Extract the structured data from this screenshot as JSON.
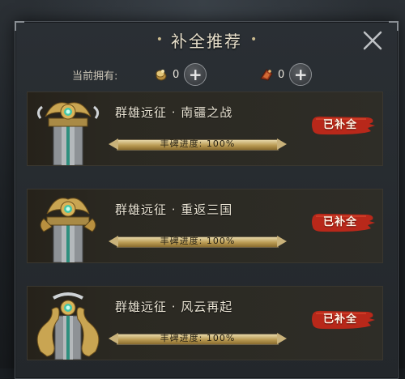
{
  "dialog": {
    "title": "补全推荐",
    "title_dot": "•"
  },
  "owned": {
    "label": "当前拥有:",
    "resources": [
      {
        "icon": "gold-token-icon",
        "count": "0"
      },
      {
        "icon": "red-token-icon",
        "count": "0"
      }
    ],
    "plus_label": "+"
  },
  "items": [
    {
      "name": "群雄远征 · 南疆之战",
      "progress_label": "丰碑进度: 100%",
      "progress": 1.0,
      "status": "已补全",
      "image": "monument-dragon-gold"
    },
    {
      "name": "群雄远征 · 重返三国",
      "progress_label": "丰碑进度: 100%",
      "progress": 1.0,
      "status": "已补全",
      "image": "monument-dragon-gold"
    },
    {
      "name": "群雄远征 · 风云再起",
      "progress_label": "丰碑进度: 100%",
      "progress": 1.0,
      "status": "已补全",
      "image": "monument-dragon-coil"
    }
  ],
  "colors": {
    "badge_red": "#b8281a",
    "progress_gold": "#c9ad6a",
    "panel_bg": "#262a2e"
  }
}
